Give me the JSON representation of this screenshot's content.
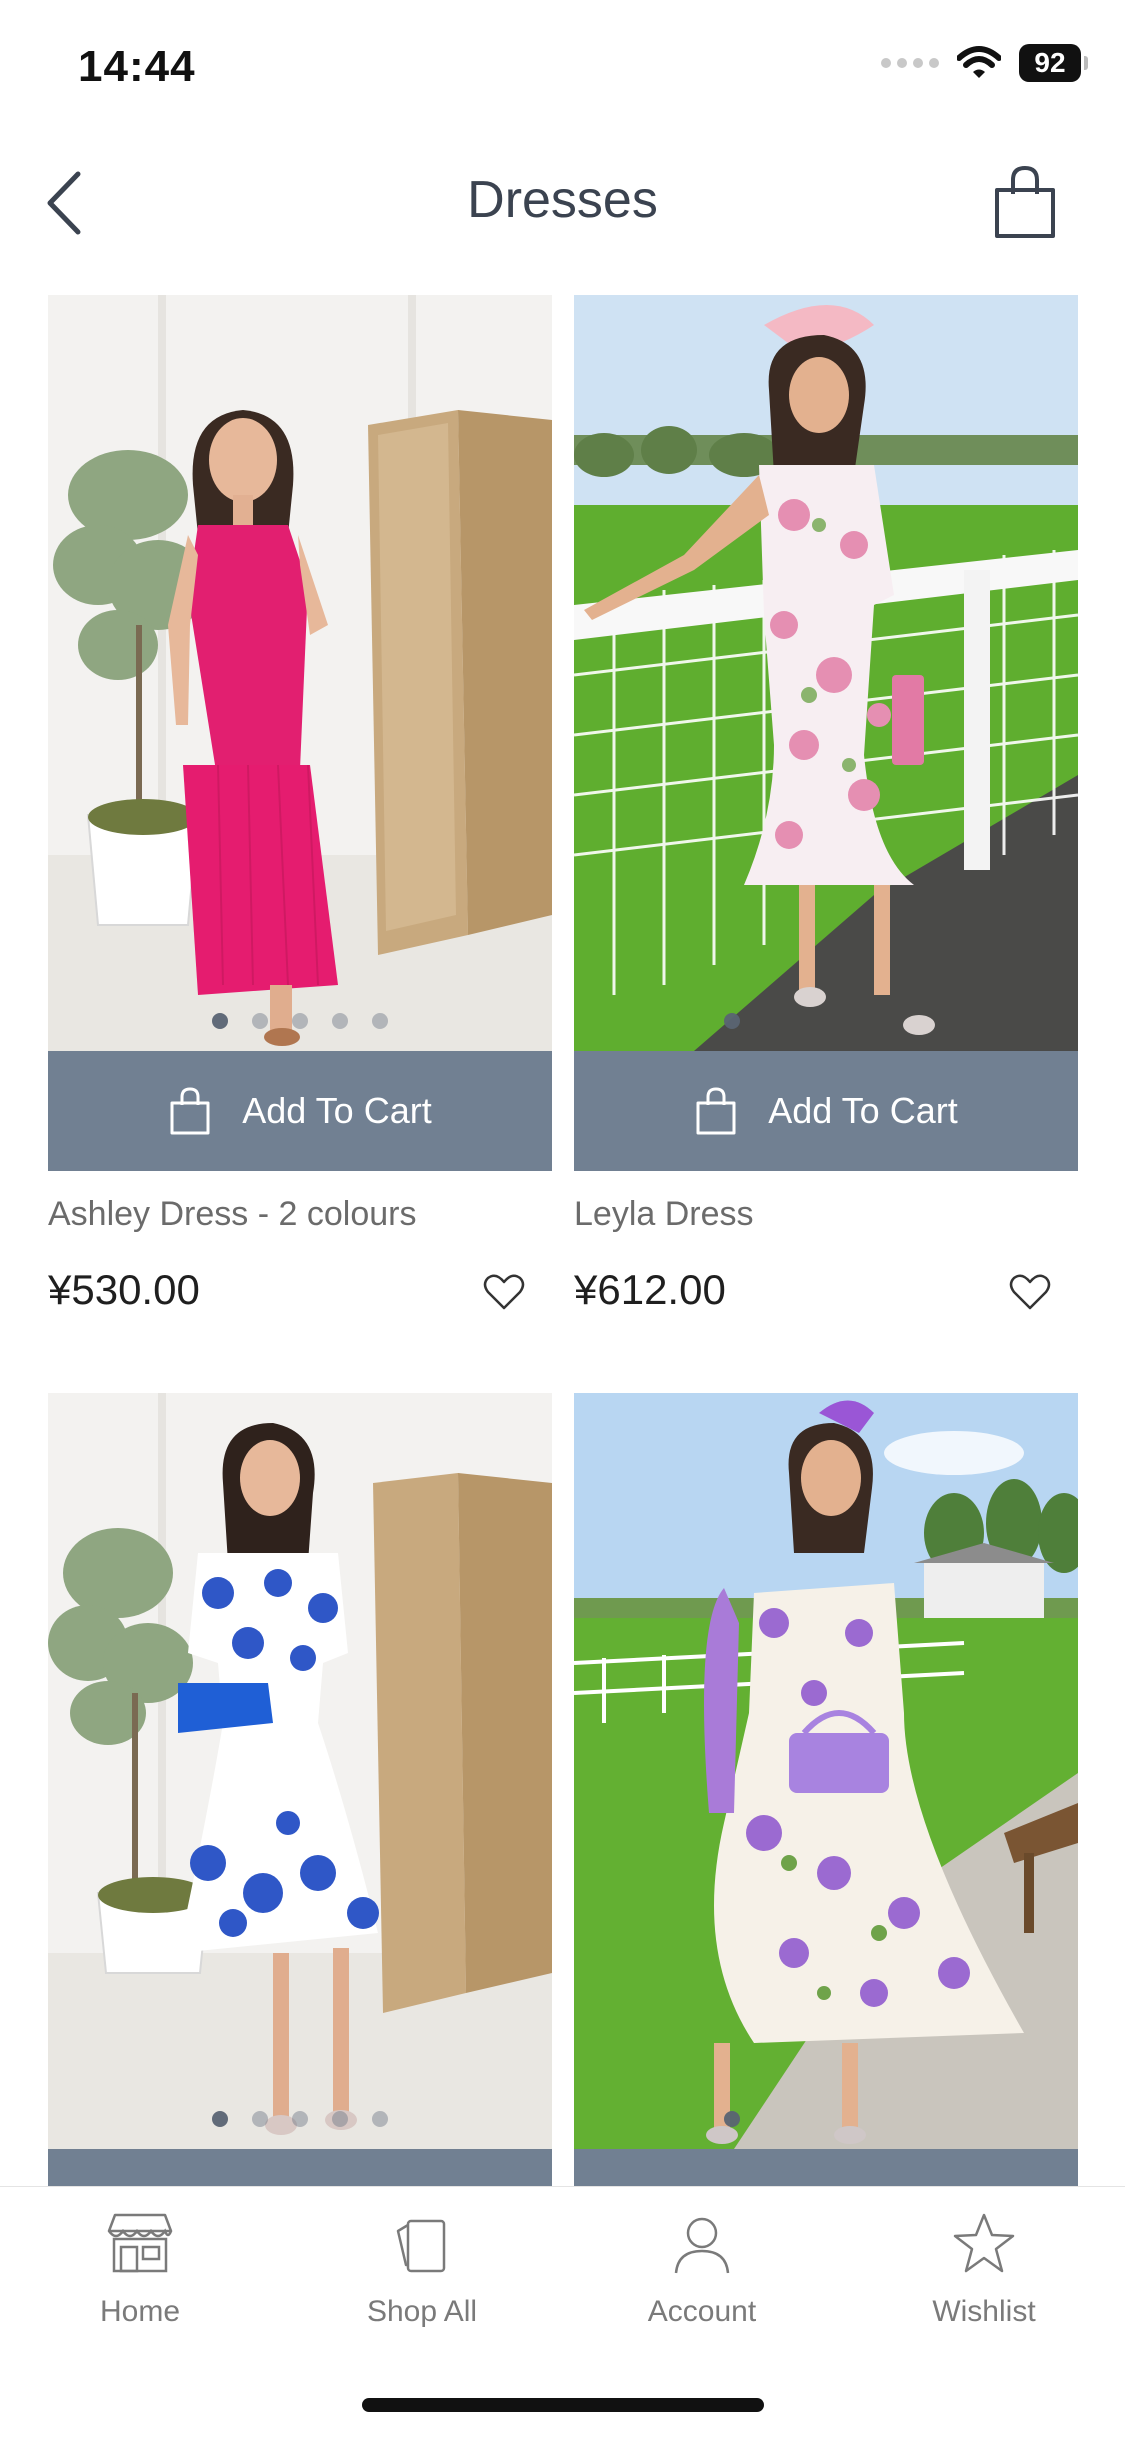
{
  "status_bar": {
    "time": "14:44",
    "battery": "92"
  },
  "header": {
    "title": "Dresses"
  },
  "products": [
    {
      "name": "Ashley Dress - 2 colours",
      "price": "¥530.00",
      "cart_label": "Add To Cart"
    },
    {
      "name": "Leyla Dress",
      "price": "¥612.00",
      "cart_label": "Add To Cart"
    },
    {
      "name": "",
      "price": "",
      "cart_label": ""
    },
    {
      "name": "",
      "price": "",
      "cart_label": ""
    }
  ],
  "tab_bar": {
    "items": [
      {
        "label": "Home",
        "icon": "shop-icon"
      },
      {
        "label": "Shop All",
        "icon": "tag-icon"
      },
      {
        "label": "Account",
        "icon": "person-icon"
      },
      {
        "label": "Wishlist",
        "icon": "star-icon"
      }
    ]
  },
  "colors": {
    "cart_button": "#718092",
    "title": "#3b4350",
    "tab_label": "#7a7a7a"
  }
}
